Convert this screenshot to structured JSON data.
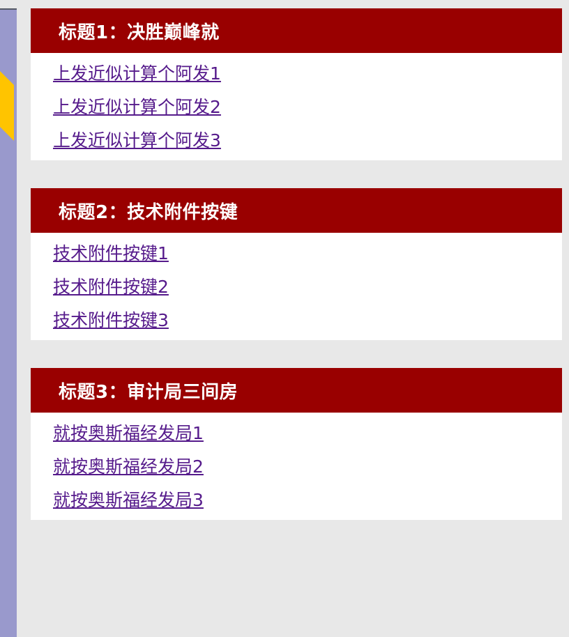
{
  "sections": [
    {
      "title": "标题1：决胜巅峰就",
      "links": [
        "上发近似计算个阿发1",
        "上发近似计算个阿发2",
        "上发近似计算个阿发3"
      ]
    },
    {
      "title": "标题2：技术附件按键",
      "links": [
        "技术附件按键1",
        "技术附件按键2",
        "技术附件按键3"
      ]
    },
    {
      "title": "标题3：审计局三间房",
      "links": [
        "就按奥斯福经发局1",
        "就按奥斯福经发局2",
        "就按奥斯福经发局3"
      ]
    }
  ],
  "colors": {
    "header_bg": "#990000",
    "link": "#551a8b",
    "page_bg": "#e8e8e8",
    "sidebar": "#9999cc",
    "accent": "#ffc400"
  }
}
